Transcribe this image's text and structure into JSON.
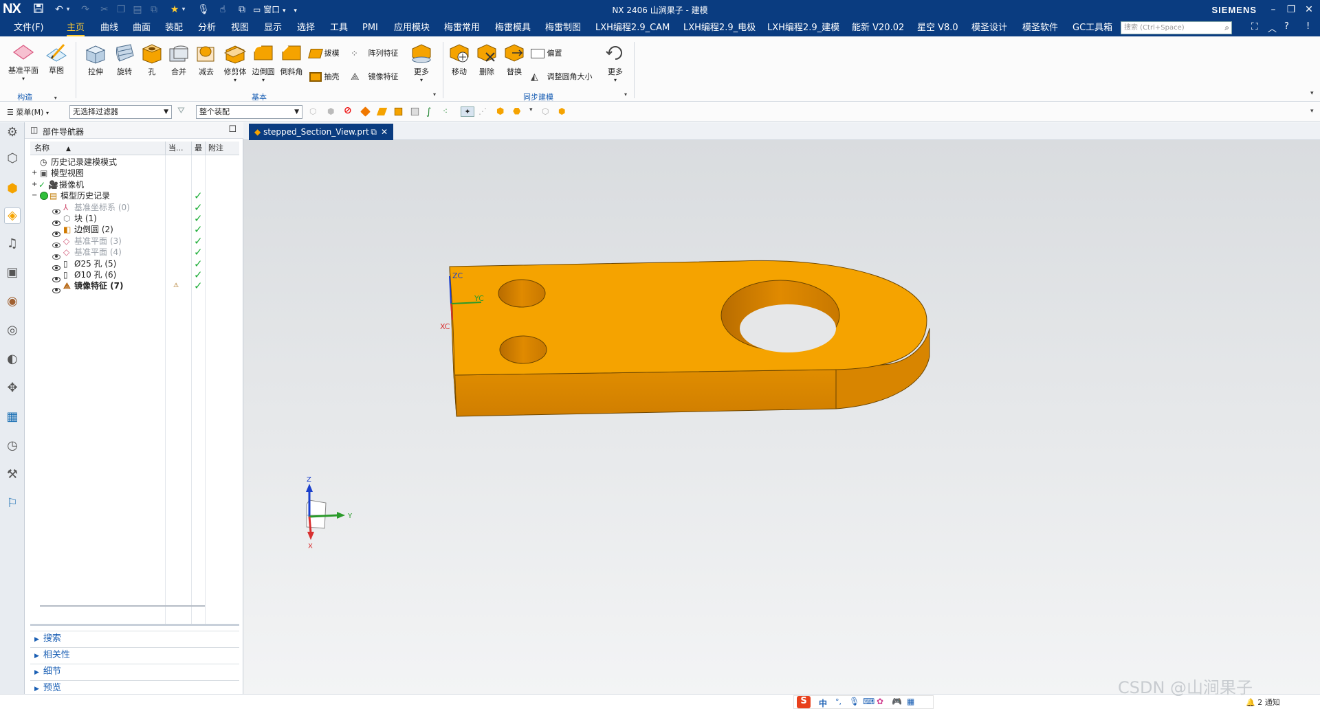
{
  "titlebar": {
    "logo": "NX",
    "title": "NX 2406 山涧果子 - 建模",
    "brand": "SIEMENS",
    "window_menu": "窗口"
  },
  "menubar": {
    "items": [
      "文件(F)",
      "主页",
      "曲线",
      "曲面",
      "装配",
      "分析",
      "视图",
      "显示",
      "选择",
      "工具",
      "PMI",
      "应用模块",
      "梅雷常用",
      "梅雷模具",
      "梅雷制图",
      "LXH编程2.9_CAM",
      "LXH编程2.9_电极",
      "LXH编程2.9_建模",
      "能新 V20.02",
      "星空 V8.0",
      "模圣设计",
      "模圣软件",
      "GC工具箱"
    ],
    "active": "主页",
    "search_placeholder": "搜索 (Ctrl+Space)"
  },
  "ribbon": {
    "construct": {
      "datum_plane": "基准平面",
      "sketch": "草图",
      "group": "构造"
    },
    "basic": {
      "extrude": "拉伸",
      "revolve": "旋转",
      "hole": "孔",
      "unite": "合并",
      "subtract": "减去",
      "trim_body": "修剪体",
      "edge_blend": "边倒圆",
      "chamfer": "倒斜角",
      "draft": "拔模",
      "pattern_feature": "阵列特征",
      "shell": "抽壳",
      "mirror_feature": "镜像特征",
      "more": "更多",
      "group": "基本"
    },
    "sync": {
      "move": "移动",
      "delete": "删除",
      "replace": "替换",
      "offset": "偏置",
      "resize_blend": "调整圆角大小",
      "more": "更多",
      "group": "同步建模"
    }
  },
  "toolbar2": {
    "menu_label": "菜单(M)",
    "filter": "无选择过滤器",
    "scope": "整个装配"
  },
  "navigator": {
    "title": "部件导航器",
    "columns": {
      "name": "名称",
      "current": "当...",
      "latest": "最",
      "note": "附注"
    },
    "rows": [
      {
        "label": "历史记录建模模式",
        "level": 0,
        "style": "normal",
        "check": ""
      },
      {
        "label": "模型视图",
        "level": 0,
        "style": "normal",
        "check": ""
      },
      {
        "label": "摄像机",
        "level": 0,
        "style": "normal",
        "check": ""
      },
      {
        "label": "模型历史记录",
        "level": 0,
        "style": "normal",
        "check": "✓"
      },
      {
        "label": "基准坐标系 (0)",
        "level": 1,
        "style": "gray",
        "check": "✓"
      },
      {
        "label": "块 (1)",
        "level": 1,
        "style": "normal",
        "check": "✓"
      },
      {
        "label": "边倒圆 (2)",
        "level": 1,
        "style": "normal",
        "check": "✓"
      },
      {
        "label": "基准平面 (3)",
        "level": 1,
        "style": "gray",
        "check": "✓"
      },
      {
        "label": "基准平面 (4)",
        "level": 1,
        "style": "gray",
        "check": "✓"
      },
      {
        "label": "Ø25 孔 (5)",
        "level": 1,
        "style": "normal",
        "check": "✓"
      },
      {
        "label": "Ø10 孔 (6)",
        "level": 1,
        "style": "normal",
        "check": "✓"
      },
      {
        "label": "镜像特征 (7)",
        "level": 1,
        "style": "bold",
        "check": "✓"
      }
    ],
    "sections": [
      "搜索",
      "相关性",
      "细节",
      "预览"
    ]
  },
  "document": {
    "tab_label": "stepped_Section_View.prt"
  },
  "viewport": {
    "part_color": "#f5a300",
    "wcs": {
      "zc": "ZC",
      "yc": "YC",
      "xc": "XC"
    },
    "triad": {
      "z": "Z",
      "y": "Y",
      "x": "X"
    }
  },
  "statusbar": {
    "ime_lang": "中",
    "notifications": "2 通知",
    "watermark": "CSDN @山涧果子"
  }
}
